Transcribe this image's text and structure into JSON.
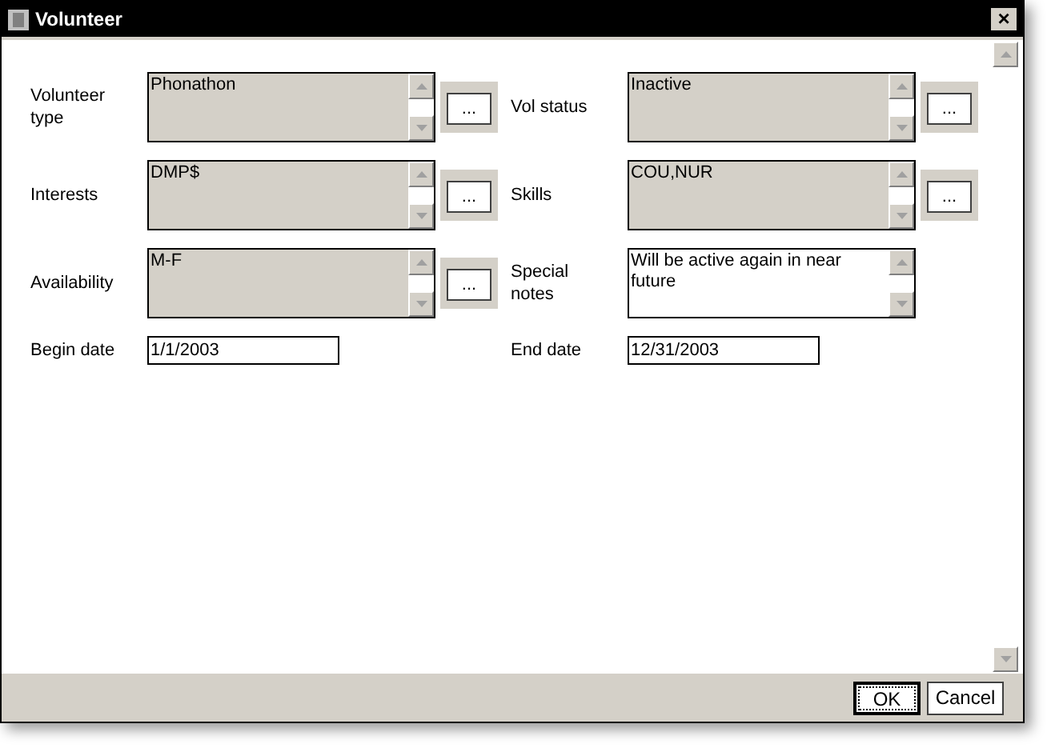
{
  "window": {
    "title": "Volunteer",
    "close": "×"
  },
  "fields": [
    {
      "label": "Volunteer type",
      "value": "Phonathon",
      "disabled": true,
      "button": "..."
    },
    {
      "label": "Vol status",
      "value": "Inactive",
      "disabled": true,
      "button": "..."
    },
    {
      "label": "Interests",
      "value": "DMP$",
      "disabled": true,
      "button": "..."
    },
    {
      "label": "Skills",
      "value": "COU,NUR",
      "disabled": true,
      "button": "..."
    },
    {
      "label": "Availability",
      "value": "M-F",
      "disabled": true,
      "button": "..."
    },
    {
      "label": "Special notes",
      "value": "Will be active again in near future",
      "disabled": false
    }
  ],
  "dates": [
    {
      "label": "Begin date",
      "value": "1/1/2003"
    },
    {
      "label": "End date",
      "value": "12/31/2003"
    }
  ],
  "buttons": [
    {
      "label": "OK",
      "default": true
    },
    {
      "label": "Cancel",
      "default": false
    }
  ]
}
